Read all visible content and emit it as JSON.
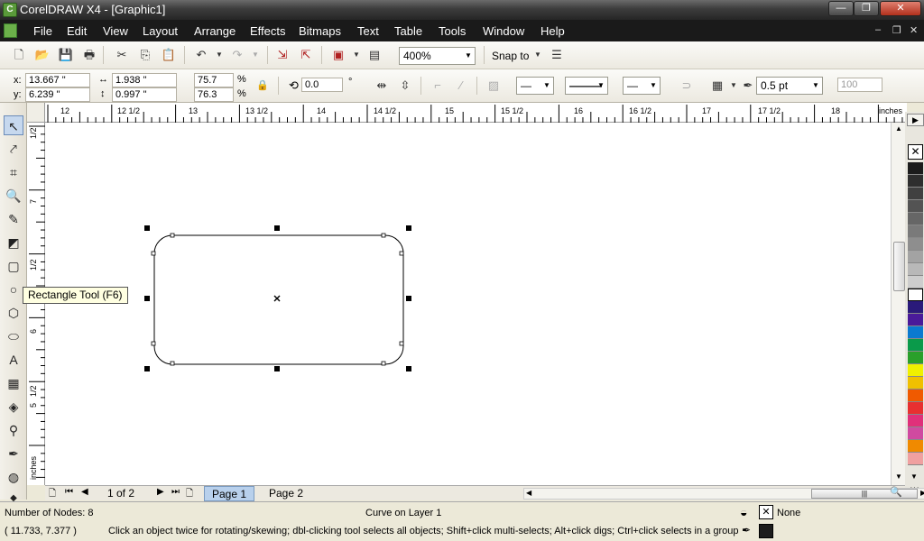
{
  "window": {
    "title": "CorelDRAW X4 - [Graphic1]",
    "minimize": "—",
    "maximize": "❐",
    "close": "✕"
  },
  "menu": [
    "File",
    "Edit",
    "View",
    "Layout",
    "Arrange",
    "Effects",
    "Bitmaps",
    "Text",
    "Table",
    "Tools",
    "Window",
    "Help"
  ],
  "toolbar": {
    "zoom": "400%",
    "snap_to": "Snap to"
  },
  "property_bar": {
    "x_label": "x:",
    "x": "13.667 \"",
    "y_label": "y:",
    "y": "6.239 \"",
    "width": "1.938 \"",
    "height": "0.997 \"",
    "scale_x": "75.7",
    "scale_y": "76.3",
    "percent": "%",
    "rotation": "0.0",
    "degree": "°",
    "outline_width": "0.5 pt",
    "opacity": "100"
  },
  "ruler": {
    "top_labels": [
      "12",
      "12 1/2",
      "13",
      "13 1/2",
      "14",
      "14 1/2",
      "15",
      "15 1/2",
      "16",
      "16 1/2",
      "17",
      "17 1/2",
      "18"
    ],
    "unit": "inches",
    "left_labels": [
      "1/2",
      "7",
      "1/2",
      "6",
      "1/2",
      "5"
    ],
    "left_unit": "inches"
  },
  "tooltip": "Rectangle Tool (F6)",
  "page_nav": {
    "counter": "1 of 2",
    "tabs": [
      "Page 1",
      "Page 2"
    ]
  },
  "status": {
    "nodes": "Number of Nodes: 8",
    "object": "Curve on Layer 1",
    "fill": "None",
    "coords": "( 11.733, 7.377 )",
    "hint": "Click an object twice for rotating/skewing; dbl-clicking tool selects all objects; Shift+click multi-selects; Alt+click digs; Ctrl+click selects in a group"
  },
  "palette_colors": [
    "#1c1c1c",
    "#2e2e2e",
    "#404040",
    "#535353",
    "#666666",
    "#7a7a7a",
    "#8e8e8e",
    "#a3a3a3",
    "#b8b8b8",
    "#cdcdcd",
    "#ffffff",
    "#2a1a7a",
    "#4a1a9a",
    "#0a7ad0",
    "#0a9a4a",
    "#2aa02a",
    "#f0f000",
    "#f0c000",
    "#f05a00",
    "#e83030",
    "#e0307a",
    "#d04aa0",
    "#f08a00",
    "#f0a0a0"
  ]
}
